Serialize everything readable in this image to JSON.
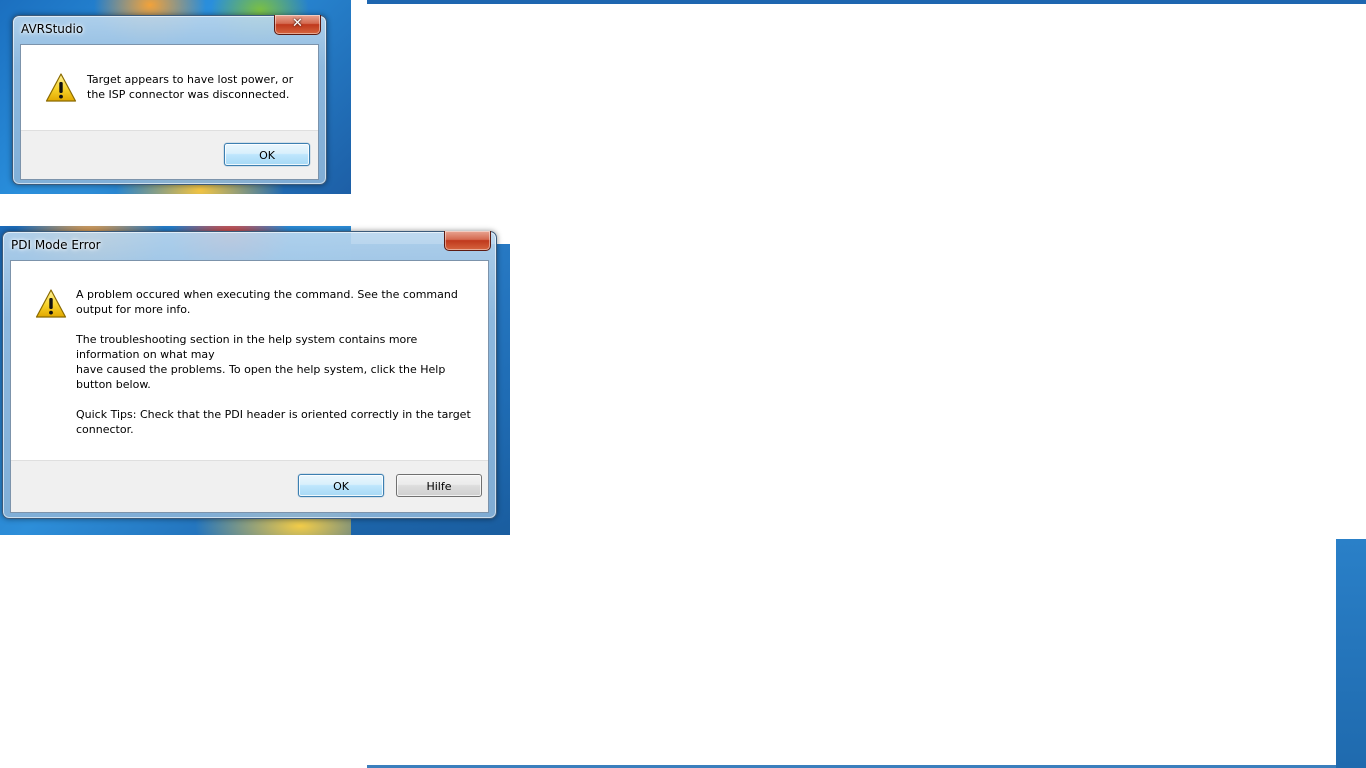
{
  "dialog_avr": {
    "title": "AVRStudio",
    "close_label": "✕",
    "message_lines": [
      "Target appears to have lost power, or",
      "the ISP connector was disconnected."
    ],
    "ok_label": "OK"
  },
  "dialog_pdi": {
    "title": "PDI Mode Error",
    "paragraphs": [
      "A problem occured when executing the command. See the command output for more info.",
      "The troubleshooting section in the help system contains more information on what may have caused the problems. To open the help system, click the Help button below.",
      "Quick Tips: Check that the PDI header is oriented correctly in the target connector."
    ],
    "paragraph_lines": [
      [
        "A problem occured when executing the command. See the command",
        "output for more info."
      ],
      [
        "The troubleshooting section in the help system contains more",
        "information on what may",
        "have caused the problems. To open the help system, click the Help",
        "button below."
      ],
      [
        "Quick Tips: Check that the PDI header is oriented correctly in the target",
        "connector."
      ]
    ],
    "ok_label": "OK",
    "help_label": "Hilfe"
  },
  "icons": {
    "warning": "warning-icon",
    "close": "close-icon"
  },
  "colors": {
    "default_button_border": "#3c7fb1",
    "close_button": "#c0381c",
    "dialog_footer": "#f0f0f0",
    "warning_yellow": "#f5c400"
  }
}
